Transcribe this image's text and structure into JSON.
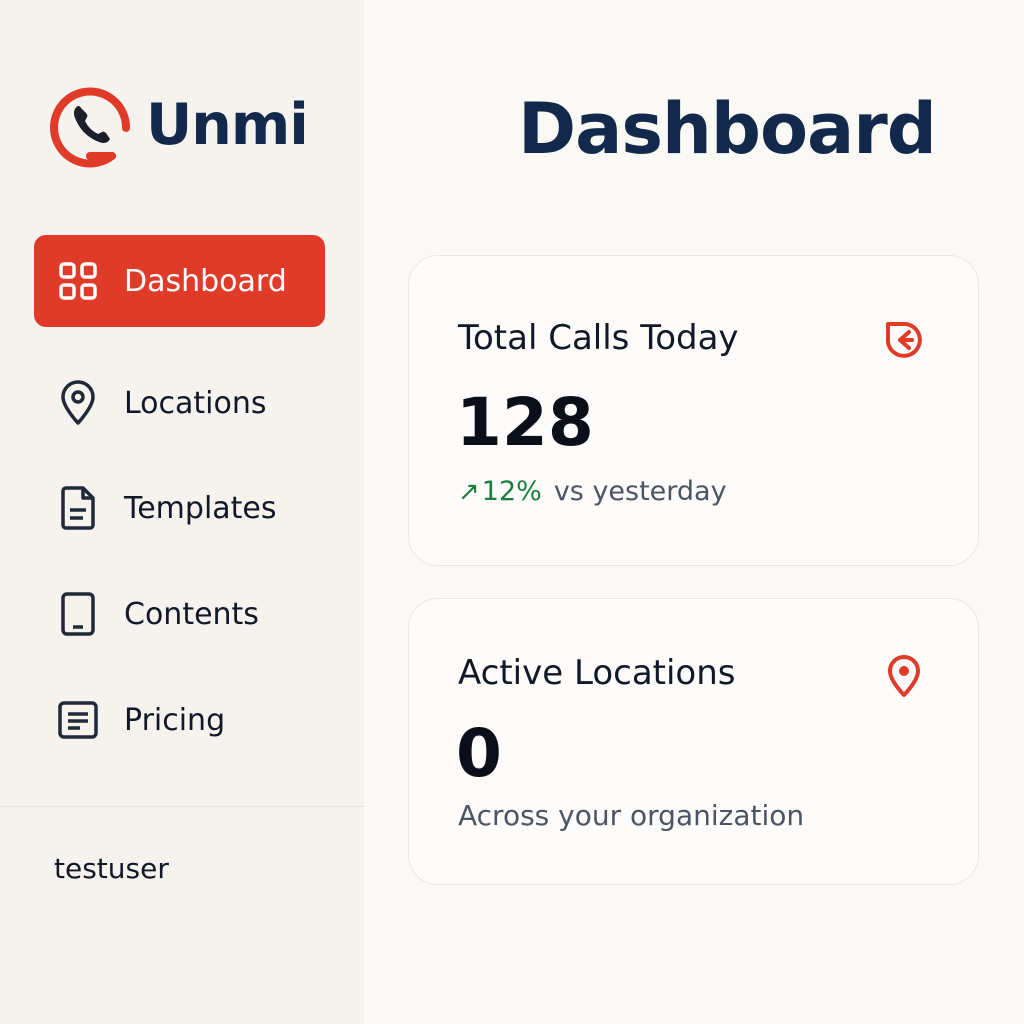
{
  "brand": {
    "name": "Unmi",
    "logo_icon": "phone-ring-logo-icon",
    "accent_color": "#e03a29",
    "name_color": "#13294b"
  },
  "sidebar": {
    "items": [
      {
        "label": "Dashboard",
        "icon": "grid-icon",
        "active": true
      },
      {
        "label": "Locations",
        "icon": "map-pin-icon",
        "active": false
      },
      {
        "label": "Templates",
        "icon": "document-icon",
        "active": false
      },
      {
        "label": "Contents",
        "icon": "tablet-icon",
        "active": false
      },
      {
        "label": "Pricing",
        "icon": "list-icon",
        "active": false
      }
    ],
    "user": "testuser"
  },
  "main": {
    "title": "Dashboard",
    "cards": [
      {
        "title": "Total Calls Today",
        "value": "128",
        "trend": "12%",
        "trend_arrow": "↗",
        "trend_color": "#1a7f3c",
        "sub": "vs yesterday",
        "icon": "call-tag-icon"
      },
      {
        "title": "Active Locations",
        "value": "0",
        "sub": "Across your organization",
        "icon": "location-pin-icon"
      }
    ]
  }
}
